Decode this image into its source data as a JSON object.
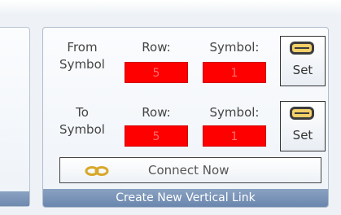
{
  "group": {
    "caption": "Create New Vertical Link",
    "from": {
      "label_line1": "From",
      "label_line2": "Symbol",
      "row_label": "Row:",
      "symbol_label": "Symbol:",
      "row_value": "5",
      "symbol_value": "1",
      "set_label": "Set",
      "set_icon": "link-set-icon"
    },
    "to": {
      "label_line1": "To",
      "label_line2": "Symbol",
      "row_label": "Row:",
      "symbol_label": "Symbol:",
      "row_value": "5",
      "symbol_value": "1",
      "set_label": "Set",
      "set_icon": "link-set-icon"
    },
    "connect": {
      "label": "Connect Now",
      "icon": "chain-link-icon"
    }
  },
  "colors": {
    "field_bg": "#ff0000",
    "caption_bg": "#7a93b8",
    "chain_icon": "#d8a82a"
  }
}
